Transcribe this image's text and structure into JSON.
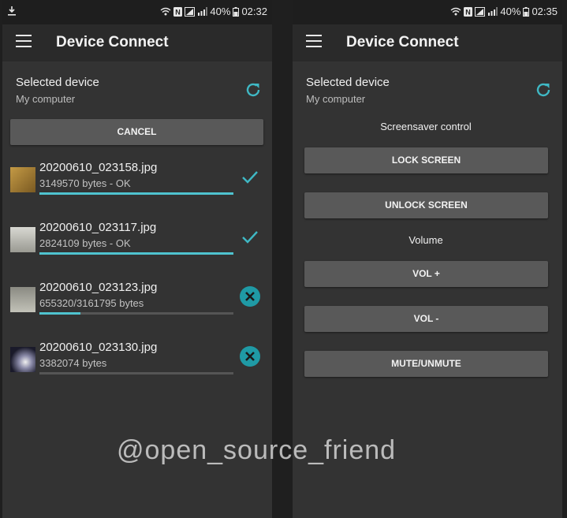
{
  "left": {
    "status": {
      "battery": "40%",
      "time": "02:32"
    },
    "app_title": "Device Connect",
    "selected_device_label": "Selected device",
    "device_name": "My computer",
    "cancel_label": "CANCEL",
    "files": [
      {
        "name": "20200610_023158.jpg",
        "size": "3149570 bytes - OK",
        "progress": 1.0,
        "state": "done"
      },
      {
        "name": "20200610_023117.jpg",
        "size": "2824109 bytes - OK",
        "progress": 1.0,
        "state": "done"
      },
      {
        "name": "20200610_023123.jpg",
        "size": "655320/3161795 bytes",
        "progress": 0.21,
        "state": "cancel"
      },
      {
        "name": "20200610_023130.jpg",
        "size": "3382074 bytes",
        "progress": 0.0,
        "state": "cancel"
      }
    ]
  },
  "right": {
    "status": {
      "battery": "40%",
      "time": "02:35"
    },
    "app_title": "Device Connect",
    "selected_device_label": "Selected device",
    "device_name": "My computer",
    "screensaver_label": "Screensaver control",
    "lock_label": "LOCK SCREEN",
    "unlock_label": "UNLOCK SCREEN",
    "volume_label": "Volume",
    "vol_up_label": "VOL +",
    "vol_down_label": "VOL -",
    "mute_label": "MUTE/UNMUTE"
  },
  "watermark": "@open_source_friend",
  "colors": {
    "accent": "#4fc3cf",
    "background": "#333333",
    "button": "#595959"
  }
}
